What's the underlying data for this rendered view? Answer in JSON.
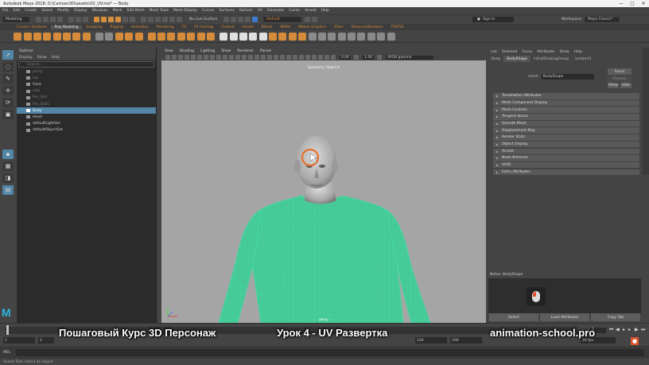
{
  "window": {
    "title": "Autodesk Maya 2018: D:\\Cartoon3D\\assets\\02_UV.ma* — Body",
    "controls": [
      "—",
      "▢",
      "✕"
    ]
  },
  "menubar": [
    "File",
    "Edit",
    "Create",
    "Select",
    "Modify",
    "Display",
    "Windows",
    "Mesh",
    "Edit Mesh",
    "Mesh Tools",
    "Mesh Display",
    "Curves",
    "Surfaces",
    "Deform",
    "UV",
    "Generate",
    "Cache",
    "Arnold",
    "Help"
  ],
  "statusline": {
    "mode": "Modeling",
    "live_surface": "No Live Surface",
    "camera_menu": "Default",
    "sign_in": "Sign In",
    "workspace_label": "Workspace:",
    "workspace_value": "Maya Classic*"
  },
  "shelf": {
    "tabs": [
      "Curves / Surfaces",
      "Poly Modeling",
      "Sculpting",
      "Rigging",
      "Animation",
      "Rendering",
      "FX",
      "FX Caching",
      "Custom",
      "Arnold",
      "Bifrost",
      "MASH",
      "Motion Graphics",
      "XGen",
      "AdvancedSkeleton",
      "TURTLE"
    ],
    "active_tab": "Poly Modeling"
  },
  "outliner": {
    "title": "Outliner",
    "menu": [
      "Display",
      "Show",
      "Help"
    ],
    "search_placeholder": "Search...",
    "items": [
      {
        "label": "persp",
        "state": "dim"
      },
      {
        "label": "top",
        "state": "dim"
      },
      {
        "label": "front",
        "state": "normal"
      },
      {
        "label": "side",
        "state": "dim"
      },
      {
        "label": "Pos_Ball",
        "state": "dim"
      },
      {
        "label": "Pos_Ball1",
        "state": "dim"
      },
      {
        "label": "Body",
        "state": "selected"
      },
      {
        "label": "Head",
        "state": "normal"
      },
      {
        "label": "defaultLightSet",
        "state": "normal"
      },
      {
        "label": "defaultObjectSet",
        "state": "normal"
      }
    ]
  },
  "viewport": {
    "menu": [
      "View",
      "Shading",
      "Lighting",
      "Show",
      "Renderer",
      "Panels"
    ],
    "near_value": "0.00",
    "far_value": "1.00",
    "color_space": "sRGB gamma",
    "symmetry_label": "Symmetry: Object X",
    "camera_label": "persp"
  },
  "attribute_editor": {
    "menu": [
      "List",
      "Selected",
      "Focus",
      "Attributes",
      "Show",
      "Help"
    ],
    "tabs": [
      "Body",
      "BodyShape",
      "initialShadingGroup",
      "lambert1"
    ],
    "active_tab": "BodyShape",
    "mesh_label": "mesh:",
    "mesh_value": "BodyShape",
    "focus_button": "Focus",
    "presets_button": "Presets",
    "show_button": "Show",
    "hide_button": "Hide",
    "sections": [
      "Tessellation Attributes",
      "Mesh Component Display",
      "Mesh Controls",
      "Tangent Space",
      "Smooth Mesh",
      "Displacement Map",
      "Render Stats",
      "Object Display",
      "Arnold",
      "Node Behavior",
      "UUID",
      "Extra Attributes"
    ],
    "notes_label": "Notes:  BodyShape",
    "bottom_buttons": [
      "Select",
      "Load Attributes",
      "Copy Tab"
    ]
  },
  "timeline": {
    "current_frame": "1",
    "range_start": "1",
    "range_inner_start": "1",
    "range_inner_end": "120",
    "range_end": "120",
    "anim_end": "200",
    "fps": "24 fps"
  },
  "command_line": {
    "label": "MEL",
    "help": "Select Tool: select an object"
  },
  "overlay": {
    "course": "Пошаговый Курс 3D Персонаж",
    "lesson": "Урок 4 - UV Развертка",
    "site": "animation-school.pro"
  },
  "colors": {
    "accent_orange": "#d58b3a",
    "selection_blue": "#5285a6",
    "wireframe_green": "#3fe0a8",
    "viewport_bg": "#a5a5a5"
  }
}
